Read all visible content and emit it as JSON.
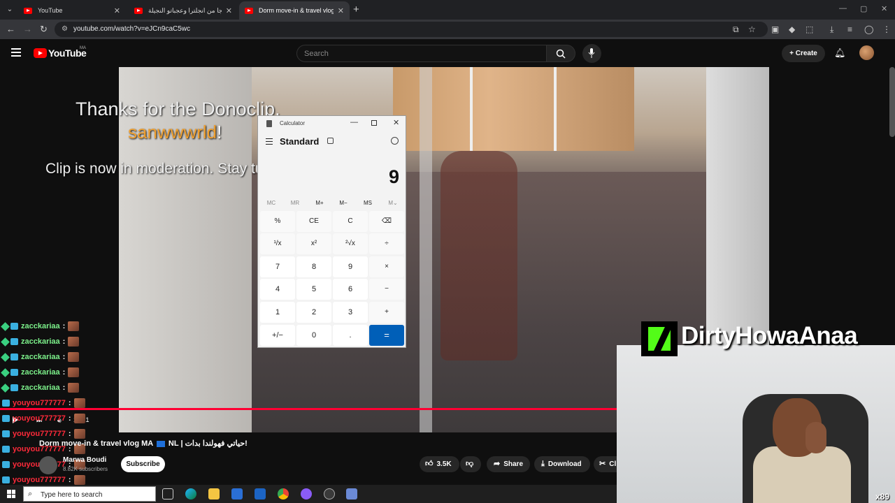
{
  "browser": {
    "tabs": [
      {
        "label": "YouTube",
        "active": false
      },
      {
        "label": "خويا جا من انجلترا وعجباتو النجيلة",
        "active": false
      },
      {
        "label": "Dorm move-in & travel vlog MA",
        "active": true
      }
    ],
    "url": "youtube.com/watch?v=eJCn9caC5wc"
  },
  "youtube": {
    "logo_text": "YouTube",
    "region": "MA",
    "search_placeholder": "Search",
    "create_label": "Create",
    "video_title_a": "Dorm move-in & travel vlog MA",
    "video_title_b": "NL | حياتي فهولندا بدات!",
    "channel_name": "Marwa Boudi",
    "channel_subs": "8.82K subscribers",
    "subscribe_label": "Subscribe",
    "likes": "3.5K",
    "share_label": "Share",
    "download_label": "Download",
    "clip_label": "Cl",
    "time": "13:21"
  },
  "overlay": {
    "thanks": "Thanks for the Donoclip,",
    "donor": "sanwwwrld",
    "donor_suffix": "!",
    "moderation": "Clip is now in moderation. Stay tuned!"
  },
  "calculator": {
    "title": "Calculator",
    "mode": "Standard",
    "display": "9",
    "memory": [
      "MC",
      "MR",
      "M+",
      "M−",
      "MS",
      "M⌄"
    ],
    "rows": [
      [
        "%",
        "CE",
        "C",
        "⌫"
      ],
      [
        "¹/x",
        "x²",
        "²√x",
        "÷"
      ],
      [
        "7",
        "8",
        "9",
        "×"
      ],
      [
        "4",
        "5",
        "6",
        "−"
      ],
      [
        "1",
        "2",
        "3",
        "+"
      ],
      [
        "+/−",
        "0",
        ".",
        "="
      ]
    ]
  },
  "chat": [
    {
      "name": "zacckariaa",
      "color": "green"
    },
    {
      "name": "zacckariaa",
      "color": "green"
    },
    {
      "name": "zacckariaa",
      "color": "green"
    },
    {
      "name": "zacckariaa",
      "color": "green"
    },
    {
      "name": "zacckariaa",
      "color": "green"
    },
    {
      "name": "youyou777777",
      "color": "red"
    },
    {
      "name": "youyou777777",
      "color": "red"
    },
    {
      "name": "youyou777777",
      "color": "red"
    },
    {
      "name": "youyou777777",
      "color": "red"
    },
    {
      "name": "youyou777777",
      "color": "red"
    },
    {
      "name": "youyou777777",
      "color": "red"
    }
  ],
  "stream": {
    "kick_name": "DirtyHowaAnaa",
    "stack_count": "x89"
  },
  "taskbar": {
    "search_placeholder": "Type here to search"
  }
}
